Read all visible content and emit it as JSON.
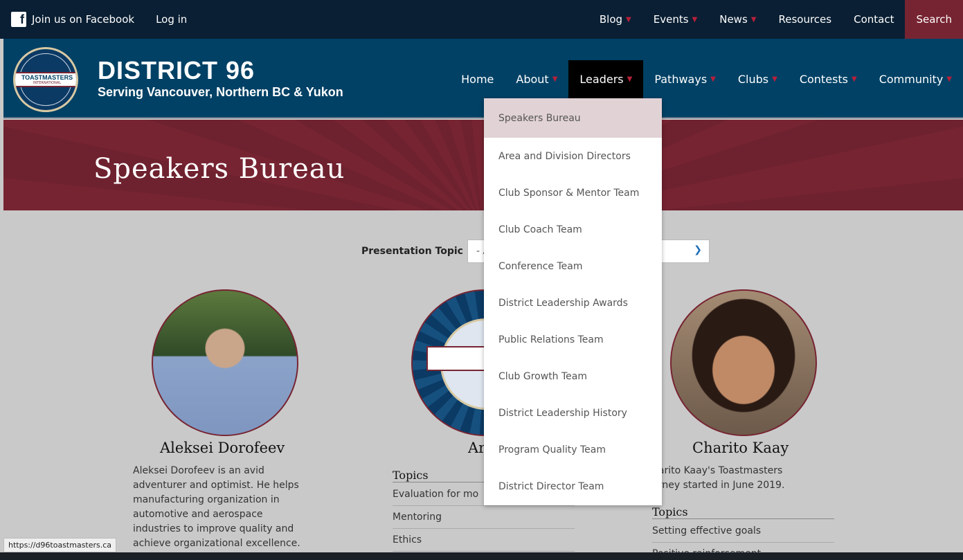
{
  "topbar": {
    "facebook": "Join us on Facebook",
    "login": "Log in",
    "links": [
      {
        "label": "Blog",
        "dropdown": true
      },
      {
        "label": "Events",
        "dropdown": true
      },
      {
        "label": "News",
        "dropdown": true
      },
      {
        "label": "Resources",
        "dropdown": false
      },
      {
        "label": "Contact",
        "dropdown": false
      }
    ],
    "search": "Search"
  },
  "header": {
    "logo_text": "TOASTMASTERS",
    "logo_sub": "INTERNATIONAL",
    "title": "DISTRICT 96",
    "subtitle": "Serving Vancouver, Northern BC & Yukon",
    "nav": [
      {
        "label": "Home",
        "dropdown": false
      },
      {
        "label": "About",
        "dropdown": true
      },
      {
        "label": "Leaders",
        "dropdown": true,
        "active": true
      },
      {
        "label": "Pathways",
        "dropdown": true
      },
      {
        "label": "Clubs",
        "dropdown": true
      },
      {
        "label": "Contests",
        "dropdown": true
      },
      {
        "label": "Community",
        "dropdown": true
      }
    ]
  },
  "banner": {
    "title": "Speakers Bureau"
  },
  "filter": {
    "label": "Presentation Topic",
    "value": "- A"
  },
  "leaders_menu": [
    "Speakers Bureau",
    "Area and Division Directors",
    "Club Sponsor & Mentor Team",
    "Club Coach Team",
    "Conference Team",
    "District Leadership Awards",
    "Public Relations Team",
    "Club Growth Team",
    "District Leadership History",
    "Program Quality Team",
    "District Director Team"
  ],
  "profiles": {
    "p1": {
      "name": "Aleksei Dorofeev",
      "bio": [
        "Aleksei Dorofeev is an avid",
        "adventurer and optimist. He helps",
        "manufacturing organization in",
        "automotive and aerospace",
        "industries to improve quality and",
        "achieve organizational excellence."
      ]
    },
    "p2": {
      "name": "Ar",
      "topics_heading": "Topics",
      "topics": [
        "Evaluation for mo",
        "Mentoring",
        "Ethics"
      ]
    },
    "p3": {
      "name": "Charito Kaay",
      "bio": [
        "harito Kaay's Toastmasters",
        "urney started in June 2019."
      ],
      "topics_heading": "Topics",
      "topics": [
        "Setting effective goals",
        "Positive reinforcement"
      ]
    }
  },
  "status_url": "https://d96toastmasters.ca",
  "colors": {
    "navy": "#004165",
    "dark": "#0a1f33",
    "maroon": "#772432",
    "accent": "#b8203a"
  }
}
